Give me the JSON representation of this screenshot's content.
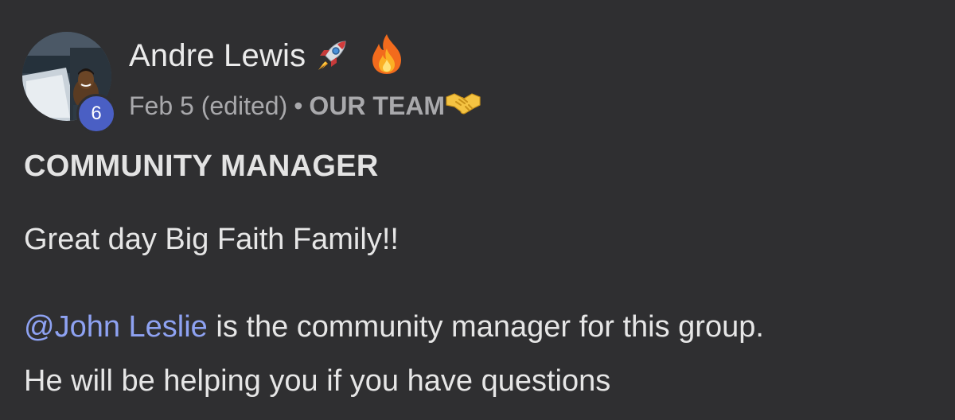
{
  "post": {
    "author": {
      "name": "Andre Lewis",
      "badges": [
        "rocket-emoji",
        "fire-emoji"
      ],
      "level": "6"
    },
    "meta": {
      "date": "Feb 5 (edited)",
      "separator": "•",
      "category": "OUR TEAM",
      "category_icon": "handshake-emoji"
    },
    "title": "COMMUNITY MANAGER",
    "body": {
      "greeting": "Great day Big Faith Family!!",
      "mention": "@John Leslie",
      "line2_rest": " is the community manager for this group.",
      "line3": "He will be helping you if you have questions"
    }
  },
  "colors": {
    "background": "#2f2f31",
    "text": "#e6e6e6",
    "muted": "#a9a9ac",
    "mention": "#8ea2f2",
    "level_badge": "#4a5fc4"
  }
}
